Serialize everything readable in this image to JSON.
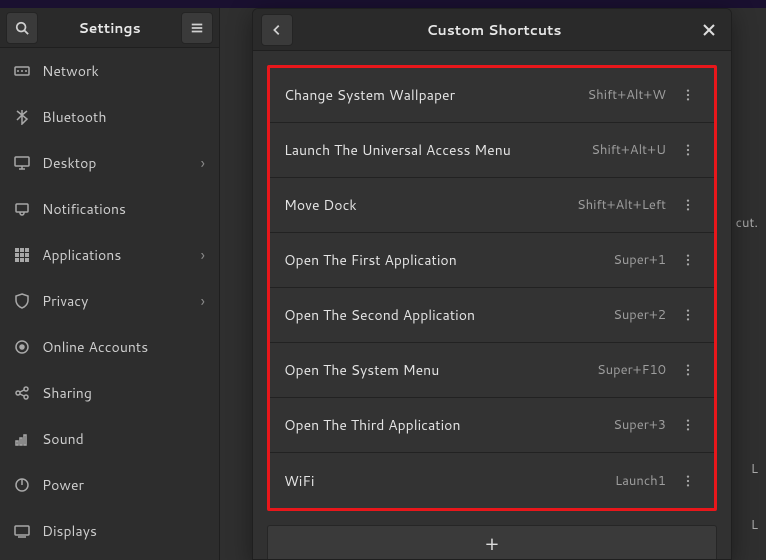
{
  "app": {
    "title": "Settings"
  },
  "sidebar": {
    "items": [
      {
        "label": "Network",
        "icon": "network",
        "chevron": false
      },
      {
        "label": "Bluetooth",
        "icon": "bluetooth",
        "chevron": false
      },
      {
        "label": "Desktop",
        "icon": "desktop",
        "chevron": true
      },
      {
        "label": "Notifications",
        "icon": "notifications",
        "chevron": false
      },
      {
        "label": "Applications",
        "icon": "apps",
        "chevron": true
      },
      {
        "label": "Privacy",
        "icon": "privacy",
        "chevron": true
      },
      {
        "label": "Online Accounts",
        "icon": "online",
        "chevron": false
      },
      {
        "label": "Sharing",
        "icon": "sharing",
        "chevron": false
      },
      {
        "label": "Sound",
        "icon": "sound",
        "chevron": false
      },
      {
        "label": "Power",
        "icon": "power",
        "chevron": false
      },
      {
        "label": "Displays",
        "icon": "displays",
        "chevron": false
      }
    ]
  },
  "dialog": {
    "title": "Custom Shortcuts",
    "addLabel": "+",
    "shortcuts": [
      {
        "name": "Change System Wallpaper",
        "keys": "Shift+Alt+W"
      },
      {
        "name": "Launch The Universal Access Menu",
        "keys": "Shift+Alt+U"
      },
      {
        "name": "Move Dock",
        "keys": "Shift+Alt+Left"
      },
      {
        "name": "Open The First Application",
        "keys": "Super+1"
      },
      {
        "name": "Open The Second Application",
        "keys": "Super+2"
      },
      {
        "name": "Open The System Menu",
        "keys": "Super+F10"
      },
      {
        "name": "Open The Third Application",
        "keys": "Super+3"
      },
      {
        "name": "WiFi",
        "keys": "Launch1"
      }
    ]
  },
  "background": {
    "hintTop": "cut.",
    "hintMid": "L",
    "hintBot": "L"
  }
}
